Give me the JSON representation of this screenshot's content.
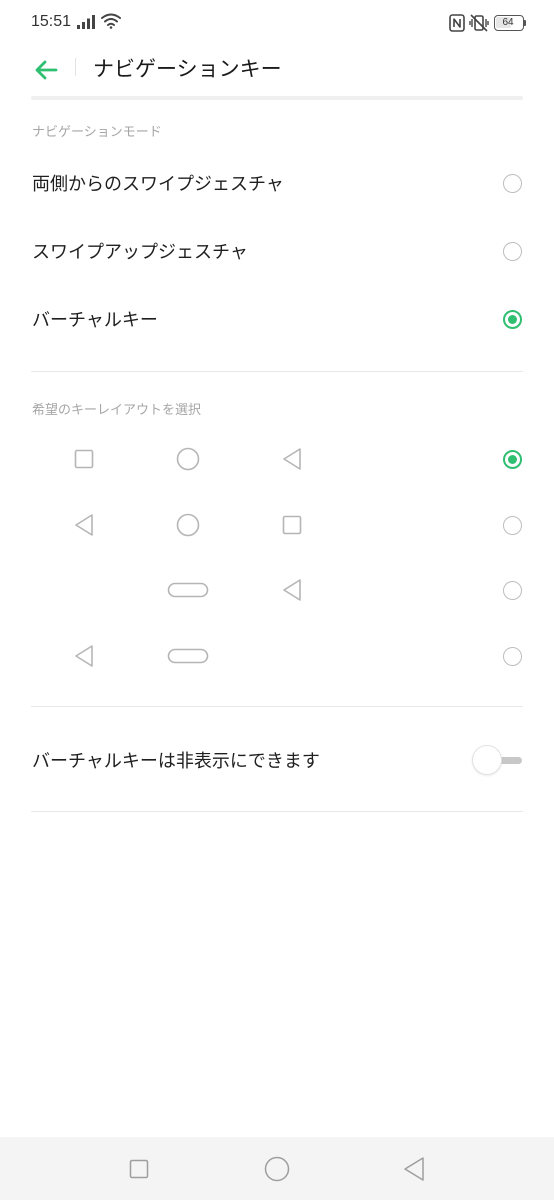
{
  "status_bar": {
    "time": "15:51",
    "battery_level": "64",
    "battery_fraction": 0.64,
    "icons": [
      "signal-icon",
      "wifi-icon",
      "nfc-icon",
      "vibrate-off-icon",
      "battery-icon"
    ]
  },
  "header": {
    "title": "ナビゲーションキー",
    "back_icon": "arrow-left-icon"
  },
  "navigation_mode": {
    "section_label": "ナビゲーションモード",
    "options": [
      {
        "label": "両側からのスワイプジェスチャ",
        "selected": false
      },
      {
        "label": "スワイプアップジェスチャ",
        "selected": false
      },
      {
        "label": "バーチャルキー",
        "selected": true
      }
    ]
  },
  "key_layout": {
    "section_label": "希望のキーレイアウトを選択",
    "layouts": [
      {
        "keys": [
          "square-icon",
          "circle-icon",
          "triangle-back-icon"
        ],
        "selected": true
      },
      {
        "keys": [
          "triangle-back-icon",
          "circle-icon",
          "square-icon"
        ],
        "selected": false
      },
      {
        "keys": [
          "pill-home-icon",
          "triangle-back-icon"
        ],
        "selected": false
      },
      {
        "keys": [
          "triangle-back-icon",
          "pill-home-icon"
        ],
        "selected": false
      }
    ]
  },
  "hide_keys": {
    "label": "バーチャルキーは非表示にできます",
    "enabled": false
  },
  "system_nav": {
    "buttons": [
      "recents-square-icon",
      "home-circle-icon",
      "back-triangle-icon"
    ]
  },
  "colors": {
    "accent": "#2fbf71",
    "text": "#1f1f1f",
    "secondary": "#a6a6a6",
    "divider": "#e8e8e8",
    "icon_gray": "#b5b5b5",
    "nav_bar": "#f4f4f4"
  }
}
